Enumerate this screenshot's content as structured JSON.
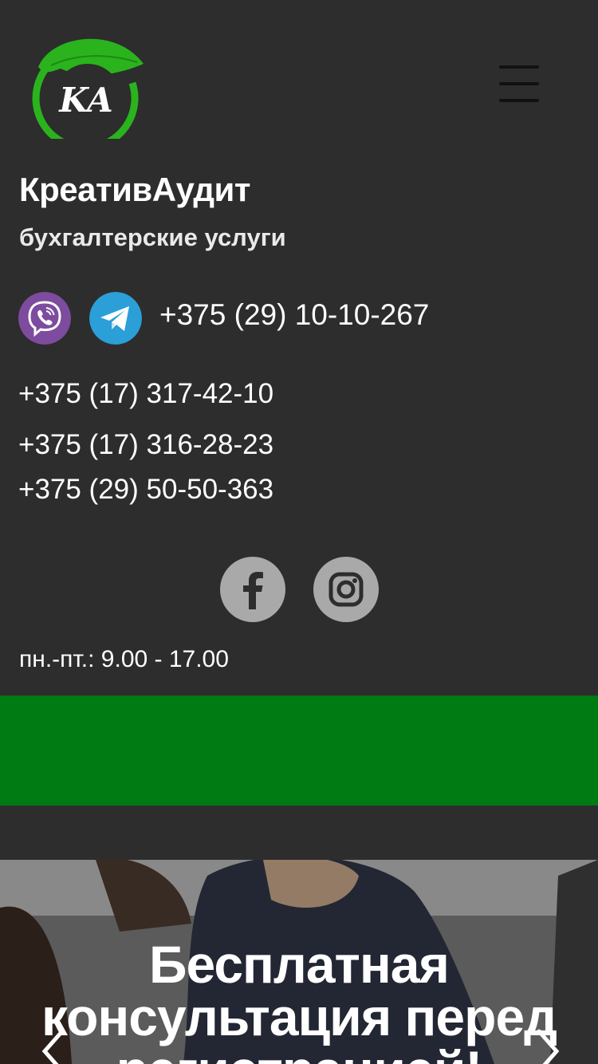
{
  "header": {
    "logo_text": "KA",
    "brand": "КреативАудит",
    "subtitle": "бухгалтерские услуги"
  },
  "contacts": {
    "main_phone": "+375 (29) 10-10-267",
    "phones": [
      "+375 (17) 317-42-10",
      "+375 (17) 316-28-23",
      "+375 (29) 50-50-363"
    ],
    "messengers": [
      "viber-icon",
      "telegram-icon"
    ],
    "social": [
      "facebook-icon",
      "instagram-icon"
    ],
    "hours": "пн.-пт.: 9.00 - 17.00"
  },
  "hero": {
    "title": "Бесплатная консультация перед регистрацией!"
  },
  "colors": {
    "background": "#2d2d2d",
    "green_band": "#007a12",
    "logo_green": "#2ab31d",
    "viber": "#7d4c9e",
    "telegram": "#2a9fd8",
    "social_bg": "#a9a9a9"
  }
}
